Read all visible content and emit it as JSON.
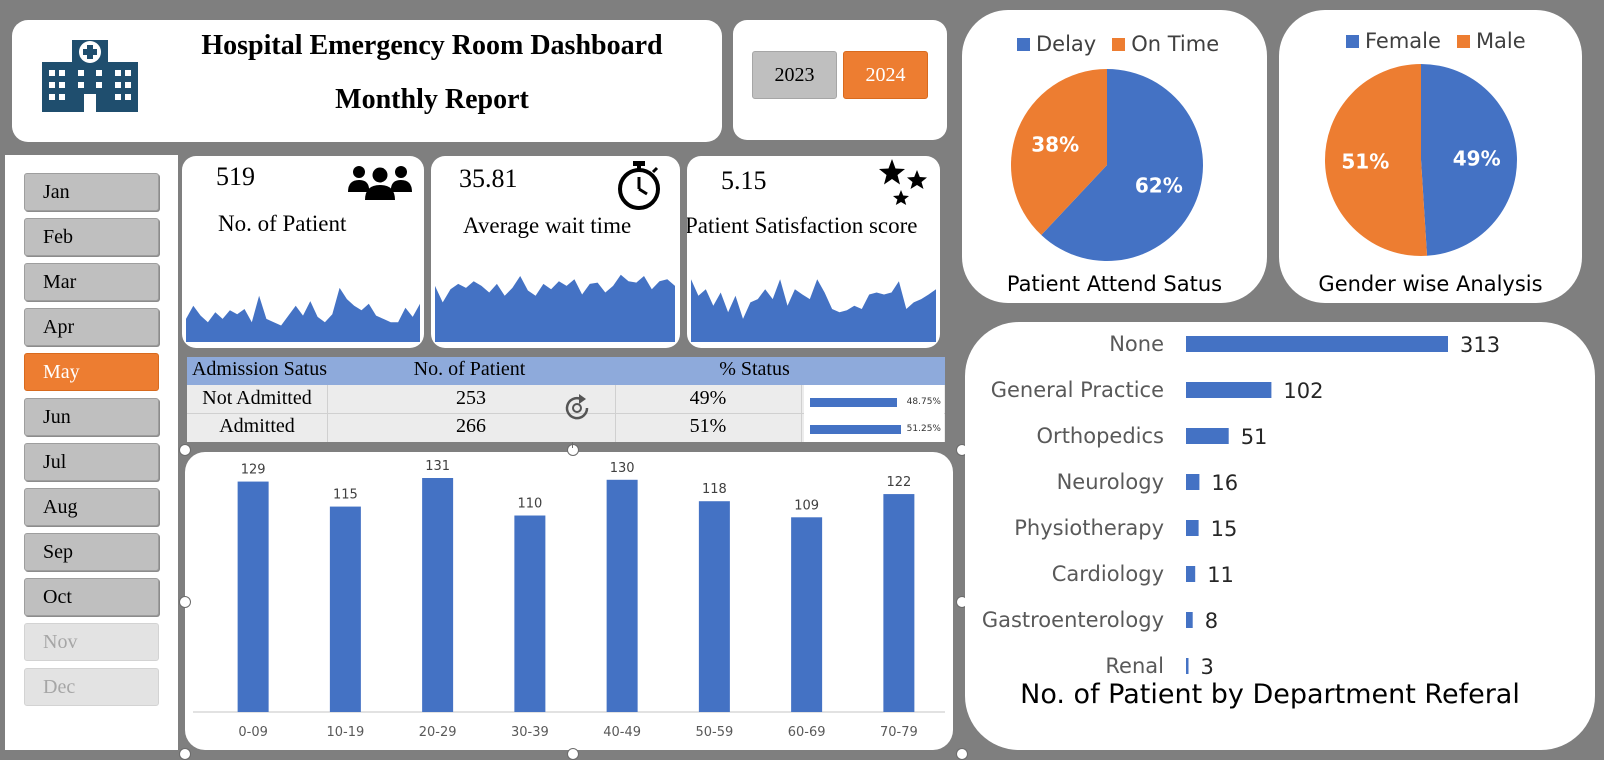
{
  "header": {
    "title": "Hospital Emergency Room Dashboard",
    "subtitle": "Monthly Report",
    "icon": "hospital-icon"
  },
  "years": [
    {
      "label": "2023",
      "selected": false
    },
    {
      "label": "2024",
      "selected": true
    }
  ],
  "months": [
    {
      "label": "Jan",
      "state": "std"
    },
    {
      "label": "Feb",
      "state": "std"
    },
    {
      "label": "Mar",
      "state": "std"
    },
    {
      "label": "Apr",
      "state": "std"
    },
    {
      "label": "May",
      "state": "sel"
    },
    {
      "label": "Jun",
      "state": "std"
    },
    {
      "label": "Jul",
      "state": "std"
    },
    {
      "label": "Aug",
      "state": "std"
    },
    {
      "label": "Sep",
      "state": "std"
    },
    {
      "label": "Oct",
      "state": "std"
    },
    {
      "label": "Nov",
      "state": "dis"
    },
    {
      "label": "Dec",
      "state": "dis"
    }
  ],
  "kpis": {
    "patients": {
      "value": "519",
      "label": "No. of Patient",
      "icon": "users-icon",
      "spark": [
        0.35,
        0.55,
        0.4,
        0.3,
        0.45,
        0.35,
        0.48,
        0.42,
        0.5,
        0.3,
        0.7,
        0.35,
        0.3,
        0.25,
        0.4,
        0.55,
        0.4,
        0.62,
        0.38,
        0.3,
        0.42,
        0.82,
        0.65,
        0.55,
        0.48,
        0.58,
        0.4,
        0.35,
        0.3,
        0.3,
        0.52,
        0.38,
        0.58
      ]
    },
    "wait_time": {
      "value": "35.81",
      "label": "Average wait time",
      "icon": "stopwatch-icon",
      "spark": [
        0.85,
        0.6,
        0.8,
        0.88,
        0.82,
        0.92,
        0.85,
        0.75,
        0.88,
        0.7,
        0.82,
        1.0,
        0.78,
        0.7,
        0.88,
        0.8,
        0.92,
        0.85,
        0.95,
        0.72,
        0.88,
        0.9,
        0.75,
        0.85,
        1.02,
        0.92,
        0.9,
        1.0,
        0.8,
        0.92,
        0.95,
        0.85
      ]
    },
    "satisfaction": {
      "value": "5.15",
      "label": "Patient Satisfaction score",
      "icon": "stars-icon",
      "spark": [
        0.95,
        0.7,
        0.8,
        0.55,
        0.75,
        0.45,
        0.7,
        0.35,
        0.6,
        0.65,
        0.8,
        0.65,
        0.95,
        0.55,
        0.8,
        0.72,
        0.65,
        0.95,
        0.75,
        0.5,
        0.45,
        0.48,
        0.55,
        0.5,
        0.72,
        0.75,
        0.72,
        0.75,
        0.92,
        0.5,
        0.6,
        0.65,
        0.72,
        0.8
      ]
    }
  },
  "admission": {
    "headers": [
      "Admission Satus",
      "No. of Patient",
      "% Status"
    ],
    "rows": [
      {
        "status": "Not Admitted",
        "count": "253",
        "pct": "49%",
        "bar_label": "48.75%",
        "bar_value": 0.4875
      },
      {
        "status": "Admitted",
        "count": "266",
        "pct": "51%",
        "bar_label": "51.25%",
        "bar_value": 0.5125
      }
    ],
    "refresh_icon": "refresh-icon"
  },
  "colors": {
    "blue": "#4472c4",
    "orange": "#ed7d31",
    "grey_btn": "#bfbfbf",
    "header_blue": "#8eaadb"
  },
  "chart_data": [
    {
      "type": "bar",
      "categories": [
        "0-09",
        "10-19",
        "20-29",
        "30-39",
        "40-49",
        "50-59",
        "60-69",
        "70-79"
      ],
      "values": [
        129,
        115,
        131,
        110,
        130,
        118,
        109,
        122
      ],
      "title": "",
      "ylim": [
        0,
        131
      ]
    },
    {
      "type": "pie",
      "title": "Patient Attend Satus",
      "categories": [
        "Delay",
        "On Time"
      ],
      "values": [
        62,
        38
      ],
      "labels": [
        "62%",
        "38%"
      ],
      "colors": [
        "#4472c4",
        "#ed7d31"
      ],
      "legend": "top"
    },
    {
      "type": "pie",
      "title": "Gender wise Analysis",
      "categories": [
        "Female",
        "Male"
      ],
      "values": [
        49,
        51
      ],
      "labels": [
        "49%",
        "51%"
      ],
      "colors": [
        "#4472c4",
        "#ed7d31"
      ],
      "legend": "top"
    },
    {
      "type": "bar",
      "orientation": "horizontal",
      "title": "No. of Patient by Department Referal",
      "categories": [
        "None",
        "General Practice",
        "Orthopedics",
        "Neurology",
        "Physiotherapy",
        "Cardiology",
        "Gastroenterology",
        "Renal"
      ],
      "values": [
        313,
        102,
        51,
        16,
        15,
        11,
        8,
        3
      ],
      "xlim": [
        0,
        313
      ]
    }
  ]
}
